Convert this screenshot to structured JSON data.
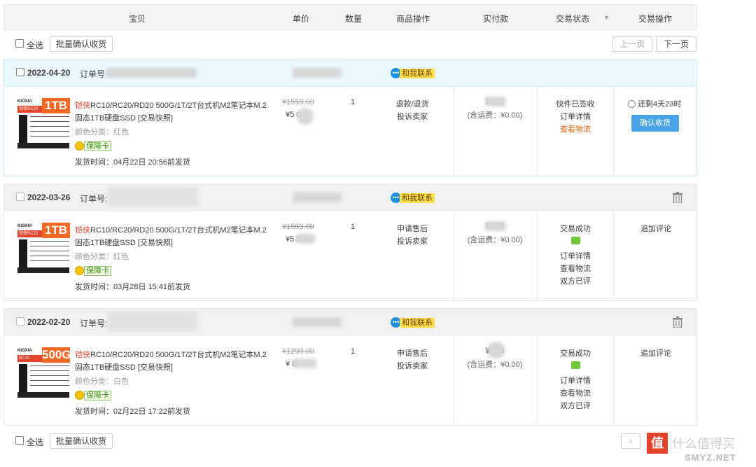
{
  "table_header": {
    "item": "宝贝",
    "unit_price": "单价",
    "quantity": "数量",
    "item_ops": "商品操作",
    "paid": "实付款",
    "status": "交易状态",
    "actions": "交易操作"
  },
  "top_toolbar": {
    "select_all": "全选",
    "batch_confirm": "批量确认收货",
    "prev_page": "上一页",
    "next_page": "下一页"
  },
  "bottom_toolbar": {
    "select_all": "全选",
    "batch_confirm": "批量确认收货"
  },
  "orders": [
    {
      "date": "2022-04-20",
      "order_label": "订单号",
      "contact": "和我联系",
      "product": {
        "brand": "KIOXIA",
        "model_badge": "铠侠RC20",
        "capacity": "1TB",
        "title_red": "铠侠",
        "title": "RC10/RC20/RD20 500G/1T/2T台式机M2笔记本M.2固态1TB硬盘SSD [交易快照]",
        "color_label": "颜色分类：红色",
        "guarantee": "保障卡",
        "ship_time": "发货时间：04月22日 20:56前发货"
      },
      "original_price": "¥1559.00",
      "price": "¥5  0",
      "quantity": "1",
      "item_ops": [
        "退款/退货",
        "投诉卖家"
      ],
      "paid": "¥    .00",
      "shipping_fee": "(含运费：¥0.00)",
      "status": [
        "快件已签收",
        "订单详情",
        "查看物流"
      ],
      "timer": "还剩4天23时",
      "confirm_button": "确认收货"
    },
    {
      "date": "2022-03-26",
      "order_label": "订单号:",
      "contact": "和我联系",
      "product": {
        "brand": "KIOXIA",
        "model_badge": "铠侠RC20",
        "capacity": "1TB",
        "title_red": "铠侠",
        "title": "RC10/RC20/RD20 500G/1T/2T台式机M2笔记本M.2固态1TB硬盘SSD [交易快照]",
        "color_label": "颜色分类：红色",
        "guarantee": "保障卡",
        "ship_time": "发货时间：03月28日 15:41前发货"
      },
      "original_price": "¥1559.00",
      "price": "¥5  0",
      "quantity": "1",
      "item_ops": [
        "申请售后",
        "投诉卖家"
      ],
      "paid": "¥    .00",
      "shipping_fee": "(含运费：¥0.00)",
      "status": [
        "交易成功",
        "订单详情",
        "查看物流",
        "双方已评"
      ],
      "action": "追加评论"
    },
    {
      "date": "2022-02-20",
      "order_label": "订单号:",
      "contact": "和我联系",
      "product": {
        "brand": "KIOXIA",
        "model_badge": "RC10",
        "capacity": "500G",
        "title_red": "铠侠",
        "title": "RC10/RC20/RD20 500G/1T/2T台式机M2笔记本M.2固态1TB硬盘SSD [交易快照]",
        "color_label": "颜色分类：白色",
        "guarantee": "保障卡",
        "ship_time": "发货时间：02月22日 17:22前发货"
      },
      "original_price": "¥1299.00",
      "price": "¥   0",
      "quantity": "1",
      "item_ops": [
        "申请售后",
        "投诉卖家"
      ],
      "paid": "¥.   00",
      "shipping_fee": "(含运费：¥0.00)",
      "status": [
        "交易成功",
        "订单详情",
        "查看物流",
        "双方已评"
      ],
      "action": "追加评论"
    }
  ],
  "watermark": {
    "logo": "值",
    "text": "什么值得买",
    "site": "SMYZ.NET"
  },
  "colors": {
    "current_order_header": "#eaf8ff",
    "order_header": "#f1f1f1",
    "confirm_button": "#4aa3e8",
    "accent_red": "#e4432b",
    "logistics_orange": "#e06010"
  }
}
